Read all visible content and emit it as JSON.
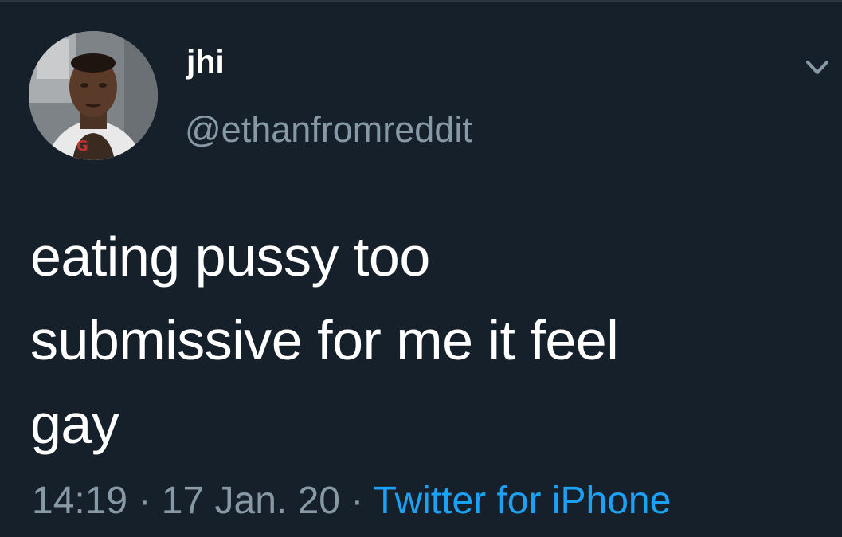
{
  "tweet": {
    "author": {
      "display_name": "jhi",
      "handle": "@ethanfromreddit"
    },
    "text_lines": [
      "eating pussy too",
      "submissive for me it feel",
      "gay"
    ],
    "time": "14:19",
    "date": "17 Jan. 20",
    "separator": "·",
    "source": "Twitter for iPhone"
  },
  "icons": {
    "menu": "chevron-down-icon",
    "avatar": "avatar"
  },
  "colors": {
    "background": "#15202b",
    "text": "#ffffff",
    "muted": "#8899a6",
    "link": "#1da1f2"
  }
}
